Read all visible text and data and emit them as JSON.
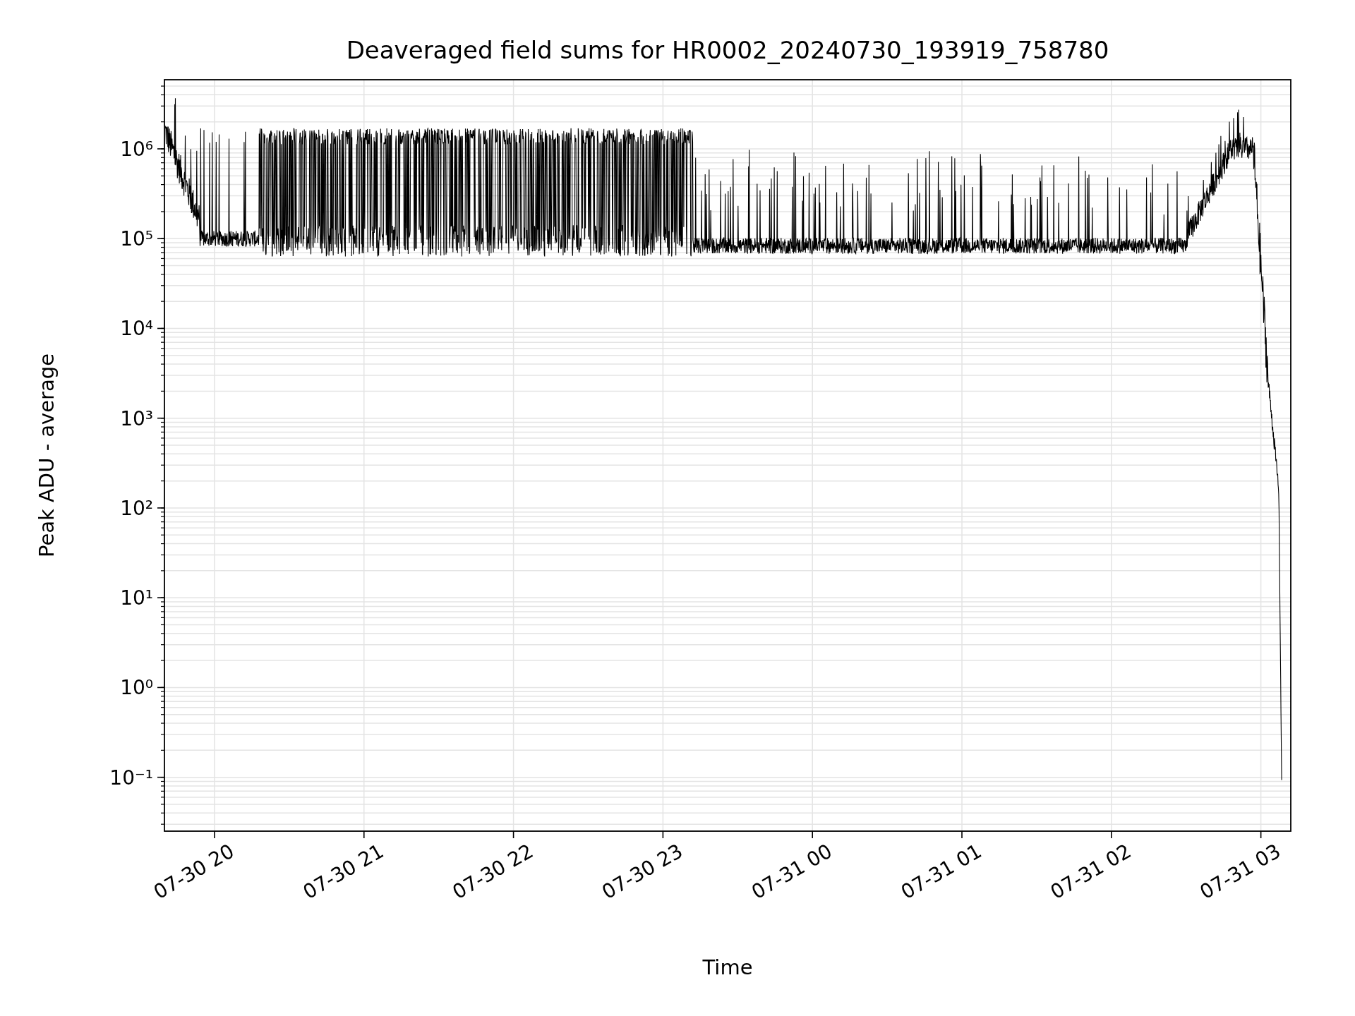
{
  "figure": {
    "title": "Deaveraged field sums for HR0002_20240730_193919_758780",
    "xlabel": "Time",
    "ylabel": "Peak ADU - average",
    "x_tick_labels": [
      "07-30 20",
      "07-30 21",
      "07-30 22",
      "07-30 23",
      "07-31 00",
      "07-31 01",
      "07-31 02",
      "07-31 03"
    ],
    "y_tick_labels": [
      "10⁶",
      "10⁵",
      "10⁴",
      "10³",
      "10²",
      "10¹",
      "10⁰",
      "10⁻¹"
    ]
  }
}
